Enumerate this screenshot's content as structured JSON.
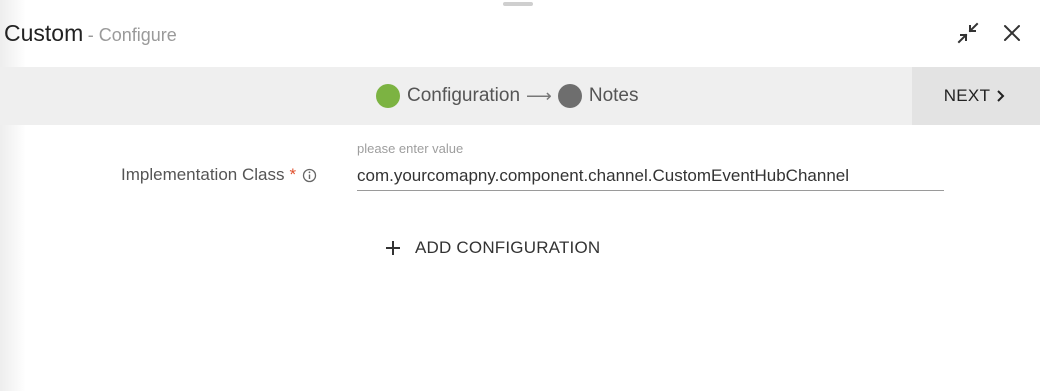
{
  "dialog": {
    "title": "Custom",
    "subtitle": "- Configure"
  },
  "header_icons": [
    "collapse-icon",
    "close-icon"
  ],
  "stepper": {
    "steps": [
      {
        "label": "Configuration",
        "color": "#7cb342",
        "status": "active"
      },
      {
        "label": "Notes",
        "color": "#6e6e6e",
        "status": "pending"
      }
    ],
    "arrow": "⟶",
    "next_label": "NEXT"
  },
  "form": {
    "field": {
      "label": "Implementation Class",
      "required_mark": "*",
      "hint": "please enter value",
      "value": "com.yourcomapny.component.channel.CustomEventHubChannel"
    },
    "add_configuration_label": "ADD CONFIGURATION"
  },
  "colors": {
    "required": "#e0502d",
    "stepper_bg": "#efefef",
    "next_bg": "#e3e3e3"
  }
}
